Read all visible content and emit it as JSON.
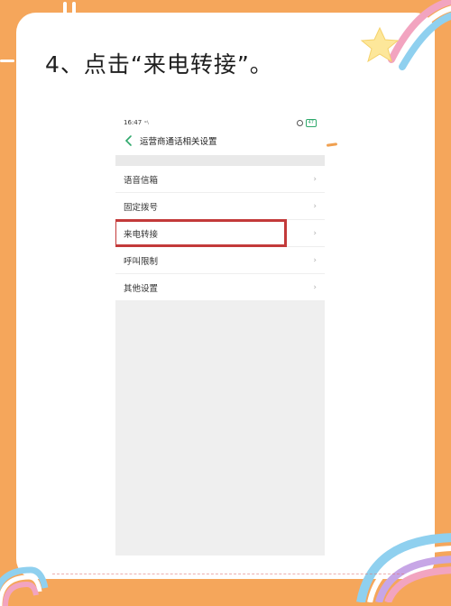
{
  "instruction": "4、点击“来电转接”。",
  "colors": {
    "background": "#f5a65b",
    "highlight": "#c33a3a",
    "accent": "#2ea86b"
  },
  "phone": {
    "status_bar": {
      "time": "16:47",
      "signal": "ᵒᴵᵢ",
      "battery": "47"
    },
    "nav": {
      "back_icon": "chevron-left-icon",
      "title": "运营商通话相关设置"
    },
    "menu_items": [
      {
        "label": "语音信箱",
        "chevron": "›"
      },
      {
        "label": "固定拨号",
        "chevron": "›"
      },
      {
        "label": "来电转接",
        "chevron": "›",
        "highlighted": true
      },
      {
        "label": "呼叫限制",
        "chevron": "›"
      },
      {
        "label": "其他设置",
        "chevron": "›"
      }
    ]
  }
}
